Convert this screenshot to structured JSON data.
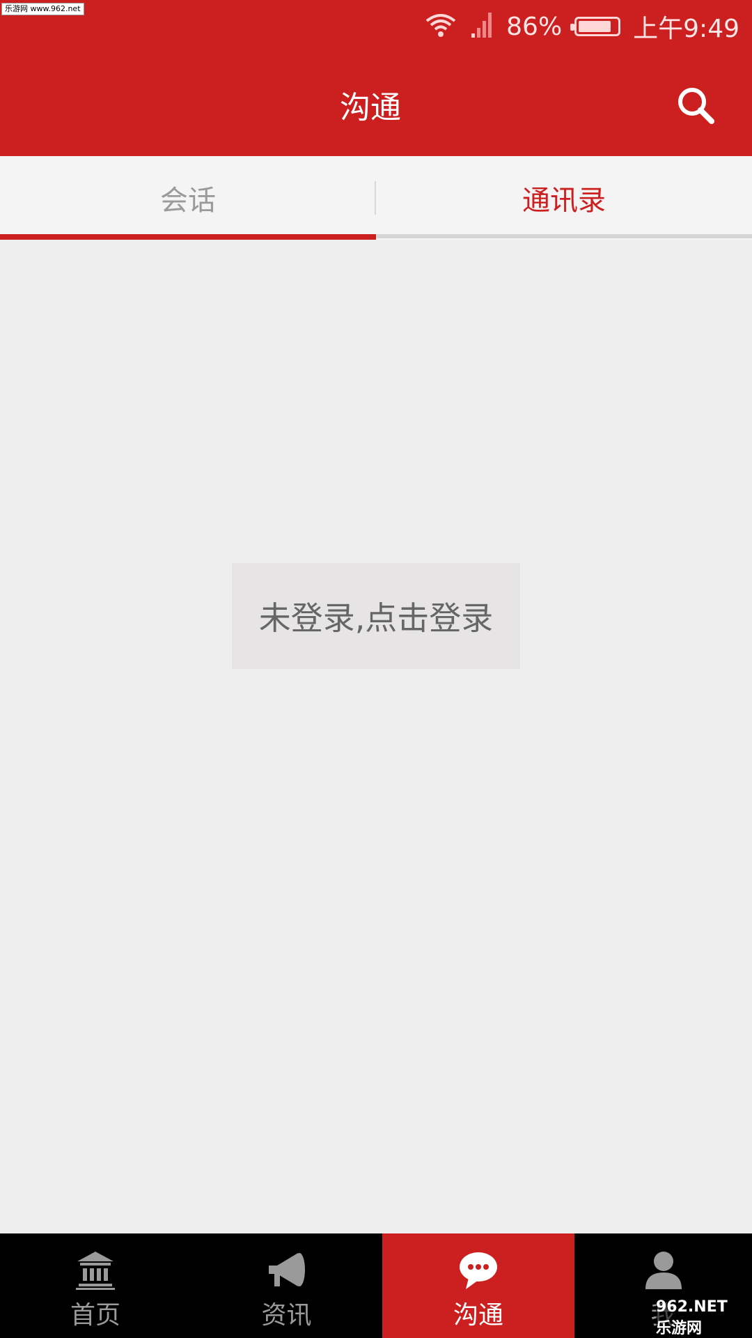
{
  "watermark_top": "乐游网 www.962.net",
  "statusbar": {
    "battery_percent": "86%",
    "time": "上午9:49",
    "battery_level": 0.86
  },
  "appbar": {
    "title": "沟通",
    "search_icon": "search-icon"
  },
  "tabs": [
    {
      "label": "会话",
      "selected": true
    },
    {
      "label": "通讯录",
      "selected": false
    }
  ],
  "login_prompt": "未登录,点击登录",
  "bottom_nav": [
    {
      "label": "首页",
      "icon": "bank-icon",
      "active": false
    },
    {
      "label": "资讯",
      "icon": "megaphone-icon",
      "active": false
    },
    {
      "label": "沟通",
      "icon": "chat-bubble-icon",
      "active": true
    },
    {
      "label": "我",
      "icon": "person-icon",
      "active": false
    }
  ],
  "watermark_bottom": "962.NET 乐游网",
  "colors": {
    "brand_red": "#cc1f20",
    "background": "#eeeeee",
    "nav_black": "#000000"
  }
}
